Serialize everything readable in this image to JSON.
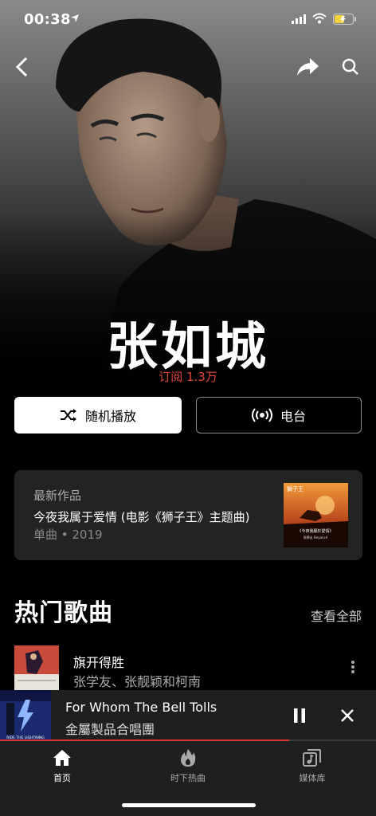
{
  "status_bar": {
    "time": "00:38"
  },
  "artist": {
    "name": "张如城",
    "subscribers": "订阅 1.3万"
  },
  "actions": {
    "shuffle_label": "随机播放",
    "radio_label": "电台"
  },
  "latest_release": {
    "heading": "最新作品",
    "title": "今夜我属于爱情 (电影《狮子王》主题曲)",
    "meta": "单曲 • 2019",
    "cover_text_top": "獅子王",
    "cover_text_title": "《今夜我願於愛情》",
    "cover_text_artist": "張學友 Beyoncé"
  },
  "popular": {
    "title": "热门歌曲",
    "see_all": "查看全部",
    "songs": [
      {
        "name": "旗开得胜",
        "artist": "张学友、张靓颖和柯南"
      }
    ]
  },
  "now_playing": {
    "title": "For Whom The Bell Tolls",
    "artist": "金屬製品合唱團",
    "progress": 0.77,
    "cover_caption": "RIDE THE LIGHTNING"
  },
  "tabs": [
    {
      "label": "首页",
      "icon": "home-icon",
      "active": true
    },
    {
      "label": "时下热曲",
      "icon": "flame-icon",
      "active": false
    },
    {
      "label": "媒体库",
      "icon": "library-icon",
      "active": false
    }
  ],
  "colors": {
    "accent": "#e0453c",
    "progress": "#e0312b",
    "card": "#232323",
    "bar": "#1f1f1f"
  }
}
